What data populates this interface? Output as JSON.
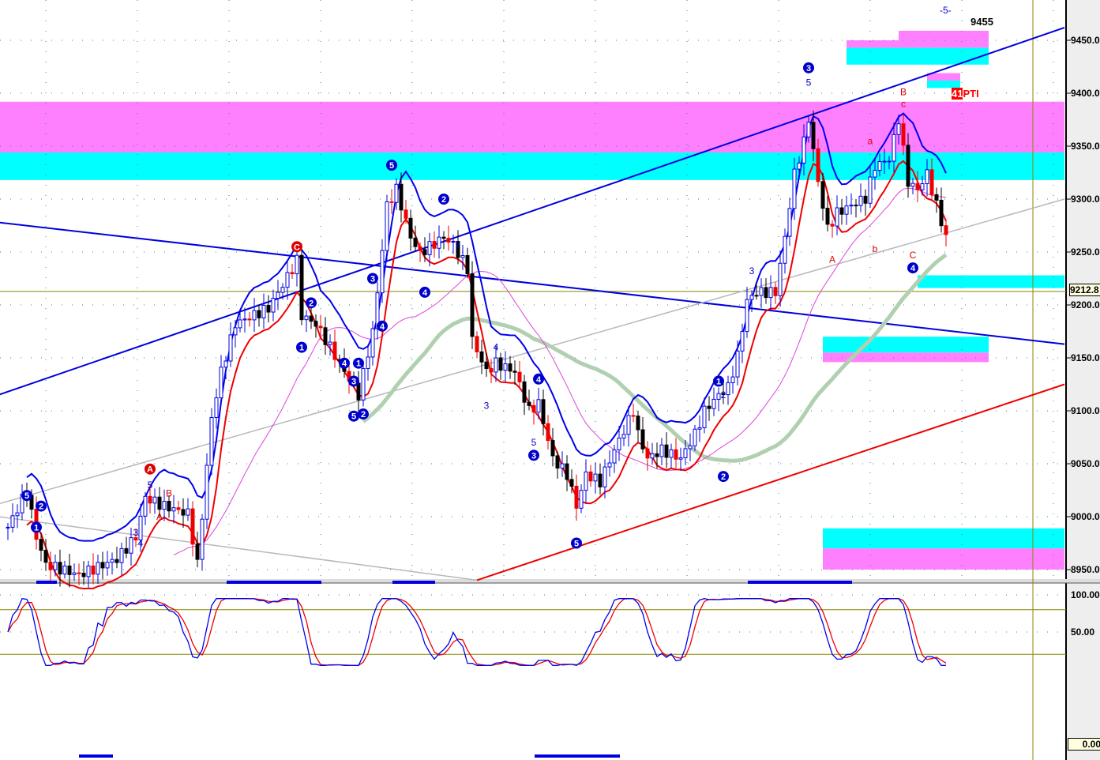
{
  "chart_data": {
    "type": "candlestick",
    "title": "",
    "header_labels": {
      "wave": "-5-",
      "target": "9455",
      "pti_value": "41",
      "pti_label": "PTI"
    },
    "price_axis": {
      "ylim": [
        8940,
        9470
      ],
      "ticks": [
        "9450.0",
        "9400.0",
        "9350.0",
        "9300.0",
        "9250.0",
        "9200.0",
        "9150.0",
        "9100.0",
        "9050.0",
        "9000.0",
        "8950.0"
      ],
      "tick_values": [
        9450,
        9400,
        9350,
        9300,
        9250,
        9200,
        9150,
        9100,
        9050,
        9000,
        8950
      ]
    },
    "last_price": {
      "value": 9212.8,
      "label": "9212.8"
    },
    "price_path": [
      [
        0,
        8990
      ],
      [
        4,
        9025
      ],
      [
        6,
        8981
      ],
      [
        8,
        8955
      ],
      [
        15,
        8945
      ],
      [
        23,
        8960
      ],
      [
        27,
        8981
      ],
      [
        29,
        9018
      ],
      [
        33,
        9010
      ],
      [
        38,
        9003
      ],
      [
        40,
        8955
      ],
      [
        43,
        9093
      ],
      [
        45,
        9137
      ],
      [
        48,
        9182
      ],
      [
        55,
        9197
      ],
      [
        58,
        9219
      ],
      [
        61,
        9242
      ],
      [
        62,
        9190
      ],
      [
        65,
        9182
      ],
      [
        68,
        9160
      ],
      [
        72,
        9130
      ],
      [
        74,
        9115
      ],
      [
        77,
        9175
      ],
      [
        78,
        9212
      ],
      [
        80,
        9294
      ],
      [
        82,
        9309
      ],
      [
        85,
        9264
      ],
      [
        87,
        9249
      ],
      [
        92,
        9264
      ],
      [
        94,
        9257
      ],
      [
        97,
        9234
      ],
      [
        98,
        9167
      ],
      [
        101,
        9137
      ],
      [
        103,
        9145
      ],
      [
        107,
        9137
      ],
      [
        110,
        9100
      ],
      [
        112,
        9107
      ],
      [
        115,
        9055
      ],
      [
        118,
        9040
      ],
      [
        120,
        9010
      ],
      [
        122,
        9040
      ],
      [
        125,
        9033
      ],
      [
        128,
        9063
      ],
      [
        132,
        9100
      ],
      [
        133,
        9078
      ],
      [
        135,
        9055
      ],
      [
        138,
        9063
      ],
      [
        142,
        9055
      ],
      [
        145,
        9078
      ],
      [
        147,
        9100
      ],
      [
        150,
        9115
      ],
      [
        152,
        9122
      ],
      [
        154,
        9152
      ],
      [
        156,
        9204
      ],
      [
        158,
        9212
      ],
      [
        162,
        9212
      ],
      [
        164,
        9264
      ],
      [
        166,
        9324
      ],
      [
        168,
        9354
      ],
      [
        169,
        9376
      ],
      [
        171,
        9316
      ],
      [
        173,
        9272
      ],
      [
        175,
        9287
      ],
      [
        178,
        9294
      ],
      [
        181,
        9301
      ],
      [
        183,
        9331
      ],
      [
        186,
        9338
      ],
      [
        188,
        9376
      ],
      [
        190,
        9316
      ],
      [
        192,
        9309
      ],
      [
        194,
        9324
      ],
      [
        197,
        9279
      ],
      [
        198,
        9264
      ]
    ],
    "wave_labels": [
      {
        "bar": 4,
        "price": 9020,
        "label": "5",
        "color": "#0000cc",
        "circle": true,
        "above": true
      },
      {
        "bar": 7,
        "price": 9010,
        "label": "2",
        "color": "#0000cc",
        "circle": true
      },
      {
        "bar": 6,
        "price": 8990,
        "label": "1",
        "color": "#0000cc",
        "circle": true
      },
      {
        "bar": 30,
        "price": 9045,
        "label": "A",
        "color": "#dd0000",
        "circle": true
      },
      {
        "bar": 30,
        "price": 9030,
        "label": "5",
        "color": "#0000cc",
        "circle": false
      },
      {
        "bar": 34,
        "price": 9022,
        "label": "B",
        "color": "#dd0000",
        "circle": false
      },
      {
        "bar": 32,
        "price": 9000,
        "label": "A",
        "color": "#dd0000",
        "circle": false
      },
      {
        "bar": 27,
        "price": 8985,
        "label": "3",
        "color": "#0000cc",
        "circle": false
      },
      {
        "bar": 28,
        "price": 8975,
        "label": "4",
        "color": "#0000cc",
        "circle": false
      },
      {
        "bar": 61,
        "price": 9255,
        "label": "C",
        "color": "#dd0000",
        "circle": true
      },
      {
        "bar": 64,
        "price": 9202,
        "label": "2",
        "color": "#0000cc",
        "circle": true
      },
      {
        "bar": 62,
        "price": 9160,
        "label": "1",
        "color": "#0000cc",
        "circle": true
      },
      {
        "bar": 71,
        "price": 9145,
        "label": "4",
        "color": "#0000cc",
        "circle": true
      },
      {
        "bar": 73,
        "price": 9128,
        "label": "3",
        "color": "#0000cc",
        "circle": true
      },
      {
        "bar": 74,
        "price": 9145,
        "label": "1",
        "color": "#0000cc",
        "circle": true
      },
      {
        "bar": 73,
        "price": 9095,
        "label": "5",
        "color": "#0000cc",
        "circle": true
      },
      {
        "bar": 75,
        "price": 9097,
        "label": "2",
        "color": "#0000cc",
        "circle": true
      },
      {
        "bar": 77,
        "price": 9225,
        "label": "3",
        "color": "#0000cc",
        "circle": true
      },
      {
        "bar": 79,
        "price": 9180,
        "label": "4",
        "color": "#0000cc",
        "circle": true
      },
      {
        "bar": 81,
        "price": 9332,
        "label": "5",
        "color": "#0000cc",
        "circle": true
      },
      {
        "bar": 92,
        "price": 9300,
        "label": "2",
        "color": "#0000cc",
        "circle": true
      },
      {
        "bar": 88,
        "price": 9212,
        "label": "4",
        "color": "#0000cc",
        "circle": true
      },
      {
        "bar": 95,
        "price": 9257,
        "label": "2",
        "color": "#0000cc",
        "circle": false
      },
      {
        "bar": 103,
        "price": 9160,
        "label": "4",
        "color": "#0000cc",
        "circle": false
      },
      {
        "bar": 101,
        "price": 9105,
        "label": "3",
        "color": "#0000cc",
        "circle": false
      },
      {
        "bar": 112,
        "price": 9130,
        "label": "4",
        "color": "#0000cc",
        "circle": true
      },
      {
        "bar": 111,
        "price": 9070,
        "label": "5",
        "color": "#0000cc",
        "circle": false
      },
      {
        "bar": 111,
        "price": 9058,
        "label": "3",
        "color": "#0000cc",
        "circle": true
      },
      {
        "bar": 120,
        "price": 8975,
        "label": "5",
        "color": "#0000cc",
        "circle": true
      },
      {
        "bar": 150,
        "price": 9128,
        "label": "1",
        "color": "#0000cc",
        "circle": true
      },
      {
        "bar": 151,
        "price": 9115,
        "label": "2",
        "color": "#0000cc",
        "circle": false
      },
      {
        "bar": 151,
        "price": 9038,
        "label": "2",
        "color": "#0000cc",
        "circle": true
      },
      {
        "bar": 157,
        "price": 9232,
        "label": "3",
        "color": "#0000cc",
        "circle": false
      },
      {
        "bar": 169,
        "price": 9424,
        "label": "3",
        "color": "#0000cc",
        "circle": true
      },
      {
        "bar": 169,
        "price": 9410,
        "label": "5",
        "color": "#0000cc",
        "circle": false
      },
      {
        "bar": 174,
        "price": 9243,
        "label": "A",
        "color": "#dd0000",
        "circle": false
      },
      {
        "bar": 182,
        "price": 9355,
        "label": "a",
        "color": "#dd0000",
        "circle": false
      },
      {
        "bar": 183,
        "price": 9253,
        "label": "b",
        "color": "#dd0000",
        "circle": false
      },
      {
        "bar": 189,
        "price": 9401,
        "label": "B",
        "color": "#dd0000",
        "circle": false
      },
      {
        "bar": 189,
        "price": 9390,
        "label": "c",
        "color": "#dd0000",
        "circle": false
      },
      {
        "bar": 191,
        "price": 9247,
        "label": "C",
        "color": "#dd0000",
        "circle": false
      },
      {
        "bar": 191,
        "price": 9235,
        "label": "4",
        "color": "#0000cc",
        "circle": true
      }
    ],
    "trend_lines": [
      {
        "from": [
          -2,
          9115
        ],
        "to": [
          223,
          9462
        ],
        "color": "#0000dd",
        "width": 2
      },
      {
        "from": [
          -2,
          9278
        ],
        "to": [
          223,
          9163
        ],
        "color": "#0000dd",
        "width": 2
      },
      {
        "from": [
          99,
          8940
        ],
        "to": [
          223,
          9125
        ],
        "color": "#ee0000",
        "width": 2
      },
      {
        "from": [
          -2,
          9012
        ],
        "to": [
          223,
          9300
        ],
        "color": "#b8b8b8",
        "width": 1.5
      },
      {
        "from": [
          -2,
          9000
        ],
        "to": [
          99,
          8940
        ],
        "color": "#b8b8b8",
        "width": 1.5
      }
    ],
    "zones": [
      {
        "bar_from": -2,
        "bar_to": 223,
        "lo": 9344,
        "hi": 9392,
        "color": "#ff80ff"
      },
      {
        "bar_from": -2,
        "bar_to": 223,
        "lo": 9318,
        "hi": 9344,
        "color": "#00ffff"
      },
      {
        "bar_from": 177,
        "bar_to": 207,
        "lo": 9427,
        "hi": 9443,
        "color": "#00ffff"
      },
      {
        "bar_from": 177,
        "bar_to": 207,
        "lo": 9443,
        "hi": 9450,
        "color": "#ff80ff"
      },
      {
        "bar_from": 188,
        "bar_to": 207,
        "lo": 9450,
        "hi": 9459,
        "color": "#ff80ff"
      },
      {
        "bar_from": 194,
        "bar_to": 201,
        "lo": 9405,
        "hi": 9412,
        "color": "#00ffff"
      },
      {
        "bar_from": 194,
        "bar_to": 201,
        "lo": 9412,
        "hi": 9419,
        "color": "#ff80ff"
      },
      {
        "bar_from": 192,
        "bar_to": 223,
        "lo": 9216,
        "hi": 9228,
        "color": "#00ffff"
      },
      {
        "bar_from": 172,
        "bar_to": 207,
        "lo": 9155,
        "hi": 9170,
        "color": "#00ffff"
      },
      {
        "bar_from": 172,
        "bar_to": 207,
        "lo": 9146,
        "hi": 9155,
        "color": "#ff80ff"
      },
      {
        "bar_from": 172,
        "bar_to": 223,
        "lo": 8970,
        "hi": 8989,
        "color": "#00ffff"
      },
      {
        "bar_from": 172,
        "bar_to": 223,
        "lo": 8950,
        "hi": 8970,
        "color": "#ff80ff"
      }
    ],
    "stochastic": {
      "ylim": [
        0,
        100
      ],
      "ticks": [
        "100.00",
        "50.00"
      ],
      "tick_values": [
        100,
        50
      ],
      "current_label": "0.00",
      "k_color": "#0000ee",
      "d_color": "#ee0000"
    }
  }
}
